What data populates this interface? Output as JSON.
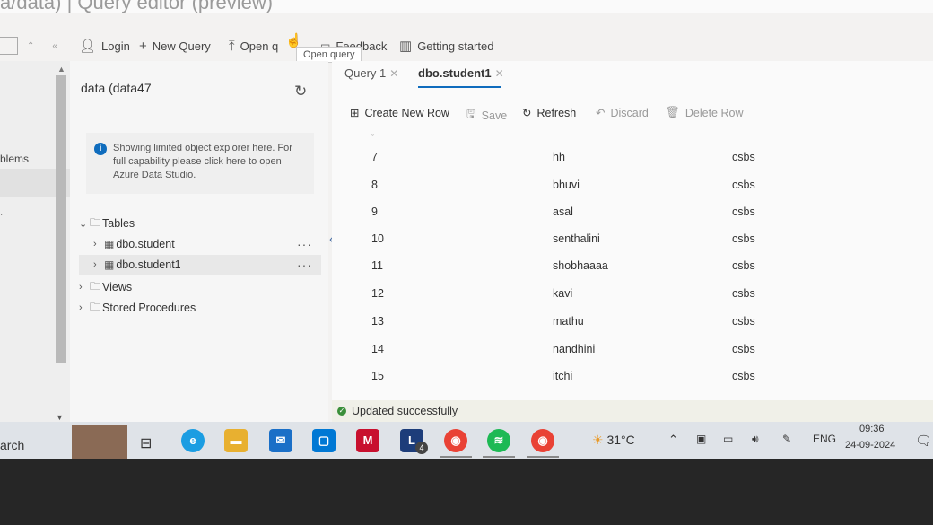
{
  "window_title": "a/data) | Query editor (preview)",
  "toolbar": {
    "login": "Login",
    "new_query": "New Query",
    "open_query": "Open q",
    "feedback": "Feedback",
    "getting_started": "Getting started",
    "tooltip": "Open query"
  },
  "left_rail": {
    "problems_label": "blems"
  },
  "sidebar": {
    "db_title": "data (data47",
    "info_text": "Showing limited object explorer here. For full capability please click here to open Azure Data Studio.",
    "tables_label": "Tables",
    "table_items": [
      "dbo.student",
      "dbo.student1"
    ],
    "views_label": "Views",
    "stored_procedures_label": "Stored Procedures"
  },
  "tabs": [
    {
      "label": "Query 1"
    },
    {
      "label": "dbo.student1"
    }
  ],
  "actions": {
    "create_new_row": "Create New Row",
    "save": "Save",
    "refresh": "Refresh",
    "discard": "Discard",
    "delete_row": "Delete Row"
  },
  "rows": [
    {
      "id": "7",
      "name": "hh",
      "dept": "csbs"
    },
    {
      "id": "8",
      "name": "bhuvi",
      "dept": "csbs"
    },
    {
      "id": "9",
      "name": "asal",
      "dept": "csbs"
    },
    {
      "id": "10",
      "name": "senthalini",
      "dept": "csbs"
    },
    {
      "id": "11",
      "name": "shobhaaaa",
      "dept": "csbs"
    },
    {
      "id": "12",
      "name": "kavi",
      "dept": "csbs"
    },
    {
      "id": "13",
      "name": "mathu",
      "dept": "csbs"
    },
    {
      "id": "14",
      "name": "nandhini",
      "dept": "csbs"
    },
    {
      "id": "15",
      "name": "itchi",
      "dept": "csbs"
    }
  ],
  "status_message": "Updated successfully",
  "taskbar": {
    "search_text": "arch",
    "badge_count": "4",
    "weather": "31°C",
    "language": "ENG",
    "time": "09:36",
    "date": "24-09-2024"
  },
  "colors": {
    "accent": "#0f6cbd",
    "success": "#3a8f3a"
  }
}
